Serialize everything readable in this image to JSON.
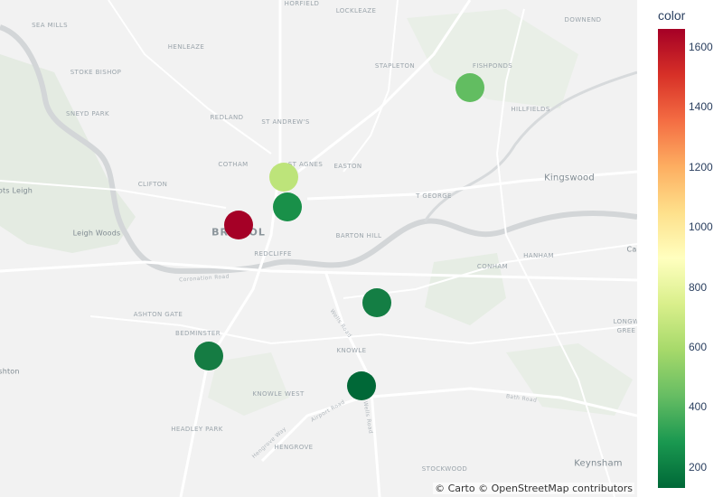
{
  "colorbar": {
    "title": "color",
    "min": 130,
    "max": 1660,
    "ticks": [
      "200",
      "400",
      "600",
      "800",
      "1000",
      "1200",
      "1400",
      "1600"
    ],
    "colorscale": [
      "#006837",
      "#1a9850",
      "#66bd63",
      "#a6d96a",
      "#d9ef8b",
      "#ffffbf",
      "#fee08b",
      "#fdae61",
      "#f46d43",
      "#d73027",
      "#a50026"
    ]
  },
  "attribution": "© Carto © OpenStreetMap contributors",
  "places": {
    "horfield": "HORFIELD",
    "lockleaze": "LOCKLEAZE",
    "sea_mills": "SEA MILLS",
    "henleaze": "HENLEAZE",
    "stoke_bishop": "STOKE BISHOP",
    "stapleton": "STAPLETON",
    "fishponds": "FISHPONDS",
    "downend": "DOWNEND",
    "sneyd_park": "SNEYD PARK",
    "redland": "REDLAND",
    "st_andrews": "ST ANDREW'S",
    "hillfields": "HILLFIELDS",
    "cotham": "COTHAM",
    "st_agnes": "ST AGNES",
    "easton": "EASTON",
    "clifton": "CLIFTON",
    "kingswood": "Kingswood",
    "abbots_leigh": "ots Leigh",
    "st_george": "T GEORGE",
    "bristol": "BRISTOL",
    "leigh_woods": "Leigh Woods",
    "barton_hill": "BARTON HILL",
    "redcliffe": "REDCLIFFE",
    "hanham": "HANHAM",
    "conham": "CONHAM",
    "ashton_gate": "ASHTON GATE",
    "bedminster": "BEDMINSTER",
    "knowle": "KNOWLE",
    "ashton": "shton",
    "longwell_green_1": "LONGW",
    "longwell_green_2": "GREE",
    "knowle_west": "KNOWLE WEST",
    "headley_park": "HEADLEY PARK",
    "hengrove": "HENGROVE",
    "stockwood": "STOCKWOOD",
    "keynsham": "Keynsham",
    "cadbury_heath": "Ca"
  },
  "roads": {
    "coronation_road": "Coronation Road",
    "wells_road": "Wells Road",
    "airport_road": "Airport Road",
    "hengrove_way": "Hengrove Way",
    "bath_road": "Bath Road"
  },
  "points": [
    {
      "id": "fishponds",
      "value": 520,
      "color": "#62bd61"
    },
    {
      "id": "st-agnes",
      "value": 680,
      "color": "#bde47a"
    },
    {
      "id": "city-centre",
      "value": 320,
      "color": "#199049"
    },
    {
      "id": "bristol",
      "value": 1660,
      "color": "#a50026"
    },
    {
      "id": "st-annes",
      "value": 260,
      "color": "#147e44"
    },
    {
      "id": "bedminster",
      "value": 270,
      "color": "#157c43"
    },
    {
      "id": "knowle",
      "value": 160,
      "color": "#006837"
    }
  ]
}
